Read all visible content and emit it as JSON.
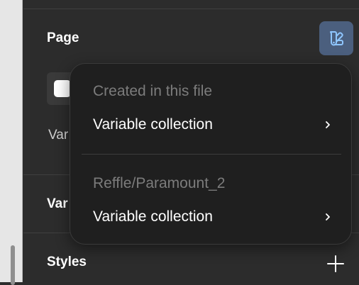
{
  "panel": {
    "page_section": {
      "title": "Page",
      "variables_label_partial": "Var"
    },
    "variables_section": {
      "title_partial": "Var"
    },
    "styles_section": {
      "title": "Styles"
    }
  },
  "dropdown": {
    "groups": [
      {
        "header": "Created in this file",
        "item_label": "Variable collection"
      },
      {
        "header": "Reffle/Paramount_2",
        "item_label": "Variable collection"
      }
    ]
  }
}
